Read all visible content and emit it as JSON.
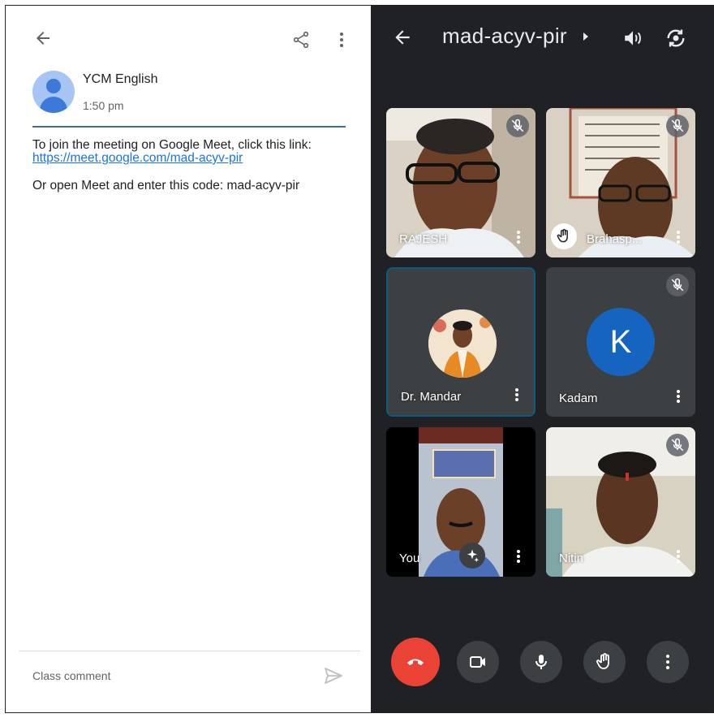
{
  "post": {
    "author": "YCM English",
    "time": "1:50 pm",
    "message_line": "To join the meeting on Google Meet, click this link:",
    "link": "https://meet.google.com/mad-acyv-pir",
    "code_line": "Or open Meet and enter this code: mad-acyv-pir"
  },
  "comment": {
    "placeholder": "Class comment"
  },
  "meet": {
    "title": "mad-acyv-pir",
    "participants": [
      {
        "name": "RAJESH",
        "muted": true
      },
      {
        "name": "Brahasp...",
        "muted": true,
        "hand_raised": true
      },
      {
        "name": "Dr. Mandar",
        "muted": false
      },
      {
        "name": "Kadam",
        "initial": "K",
        "muted": true
      },
      {
        "name": "You",
        "muted": false
      },
      {
        "name": "Nitin",
        "muted": true
      }
    ]
  },
  "colors": {
    "end_call": "#ea4335",
    "meet_bg": "#202124",
    "link": "#1a73e8",
    "avatar_k": "#1565c0"
  }
}
